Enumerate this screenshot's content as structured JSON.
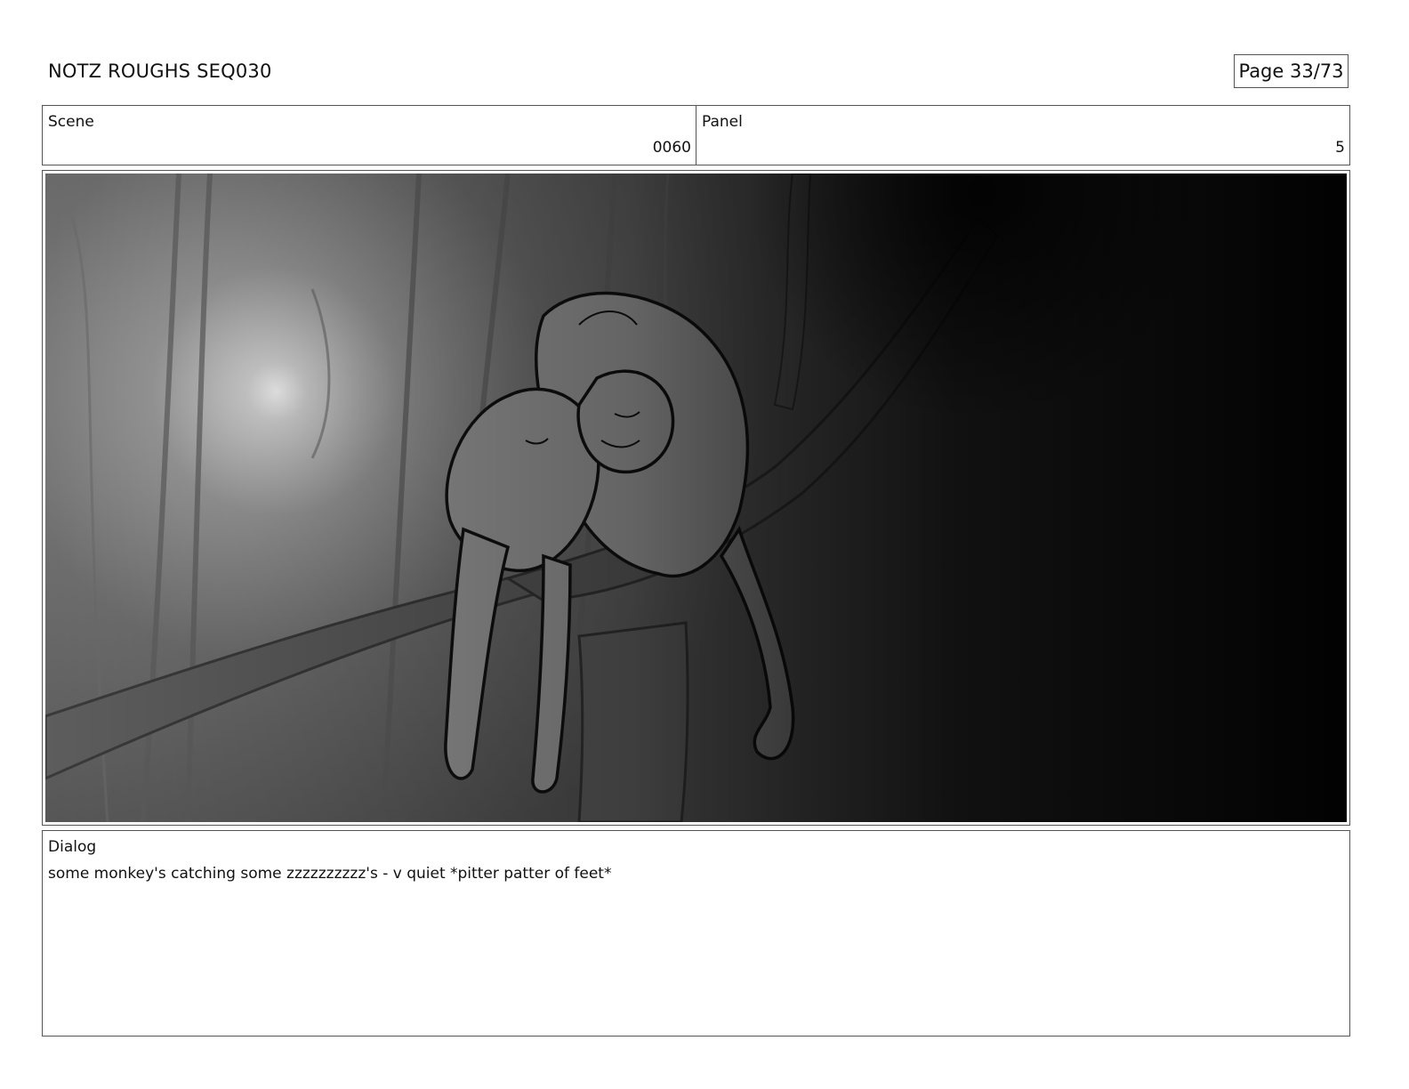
{
  "header": {
    "title": "NOTZ ROUGHS SEQ030",
    "page": "Page 33/73"
  },
  "scene": {
    "label": "Scene",
    "value": "0060"
  },
  "panel": {
    "label": "Panel",
    "value": "5"
  },
  "dialog": {
    "label": "Dialog",
    "text": "some monkey's catching some zzzzzzzzzz's - v quiet *pitter patter of feet*"
  },
  "artwork": {
    "description_icon": "storyboard-sketch-monkeys-sleeping-on-branch",
    "palette": [
      "#ffffff",
      "#8a8a8a",
      "#5a5a5a",
      "#3a3a3a",
      "#0a0a0a"
    ]
  }
}
